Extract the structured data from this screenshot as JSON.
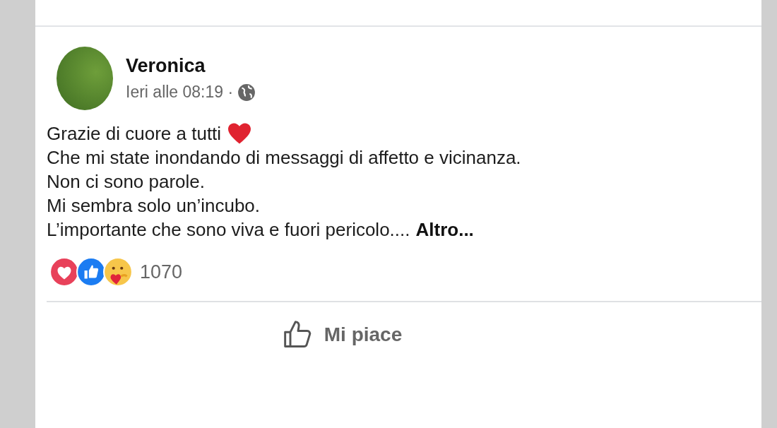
{
  "post": {
    "author": "Veronica",
    "timestamp": "Ieri alle 08:19 ·",
    "lines": [
      "Grazie di cuore a tutti",
      "Che mi state inondando di messaggi di affetto e vicinanza.",
      "Non ci sono parole.",
      "Mi sembra solo un’incubo.",
      "L’importante che sono viva e fuori pericolo...."
    ],
    "more_link": "Altro...",
    "reaction_count": "1070",
    "actions": [
      {
        "label": "Mi piace",
        "kind": "like"
      }
    ]
  }
}
